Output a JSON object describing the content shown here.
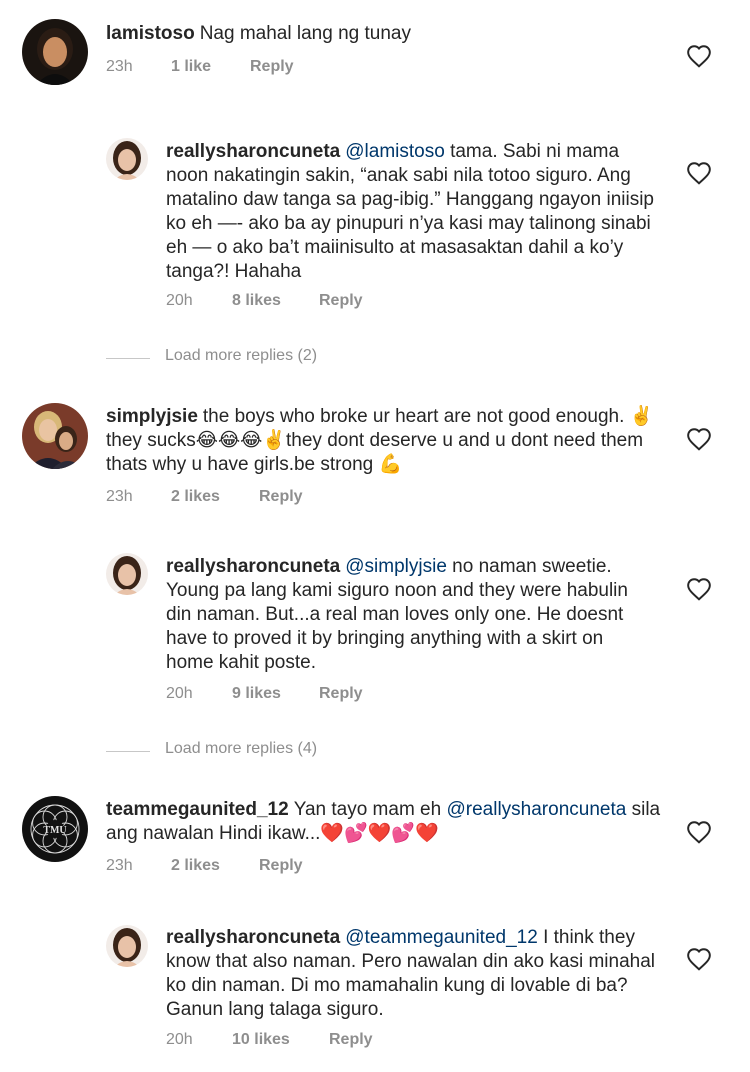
{
  "comments": [
    {
      "username": "lamistoso",
      "text": "Nag mahal lang ng tunay",
      "time": "23h",
      "likes": "1 like",
      "reply": "Reply",
      "avatar": "avatar-lamistoso"
    },
    {
      "username": "reallysharoncuneta",
      "mention": "@lamistoso",
      "text": "tama. Sabi ni mama noon nakatingin sakin, “anak sabi nila totoo siguro. Ang matalino daw tanga sa pag-ibig.” Hanggang ngayon iniisip ko eh —- ako ba ay pinupuri n’ya kasi may talinong sinabi eh — o ako ba’t maiinisulto at masasaktan dahil a ko’y tanga?! Hahaha",
      "time": "20h",
      "likes": "8 likes",
      "reply": "Reply",
      "avatar": "avatar-reallysharoncuneta"
    },
    {
      "load_more": "Load more replies (2)"
    },
    {
      "username": "simplyjsie",
      "text": "the boys who broke ur heart are not good enough. ✌️they sucks😂😂😂✌️they dont  deserve u and u dont need them thats why u have girls.be strong 💪",
      "time": "23h",
      "likes": "2 likes",
      "reply": "Reply",
      "avatar": "avatar-simplyjsie"
    },
    {
      "username": "reallysharoncuneta",
      "mention": "@simplyjsie",
      "text": "no naman sweetie. Young pa lang kami siguro noon and they were habulin din naman. But...a real man loves only one. He doesnt have to proved it by bringing anything with a skirt on home kahit poste.",
      "time": "20h",
      "likes": "9 likes",
      "reply": "Reply",
      "avatar": "avatar-reallysharoncuneta"
    },
    {
      "load_more": "Load more replies (4)"
    },
    {
      "username": "teammegaunited_12",
      "text_before": "Yan tayo mam eh",
      "mention": "@reallysharoncuneta",
      "text": "sila ang nawalan Hindi ikaw...❤️💕❤️💕❤️",
      "time": "23h",
      "likes": "2 likes",
      "reply": "Reply",
      "avatar": "avatar-teammegaunited"
    },
    {
      "username": "reallysharoncuneta",
      "mention": "@teammegaunited_12",
      "text": "I think they know that also naman. Pero nawalan din ako kasi minahal ko din naman. Di mo mamahalin kung di lovable di ba? Ganun lang talaga siguro.",
      "time": "20h",
      "likes": "10 likes",
      "reply": "Reply",
      "avatar": "avatar-reallysharoncuneta"
    }
  ],
  "icons": {
    "like": "heart-outline-icon"
  },
  "colors": {
    "text": "#262626",
    "meta": "#8e8e8e",
    "mention": "#00376b"
  }
}
